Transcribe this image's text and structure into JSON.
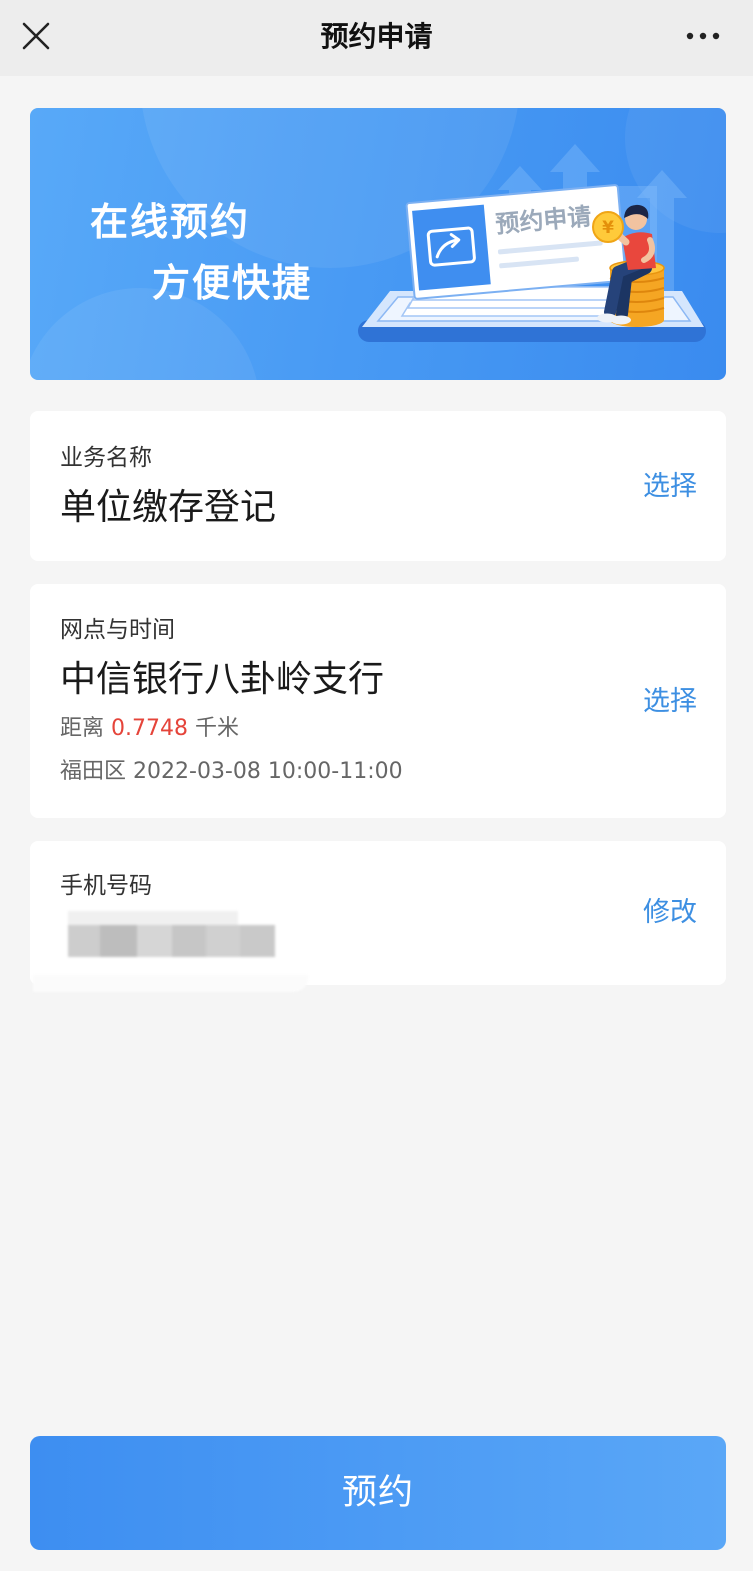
{
  "nav": {
    "title": "预约申请",
    "close_icon": "close-icon",
    "more_icon": "more-icon"
  },
  "banner": {
    "line1": "在线预约",
    "line2": "方便快捷",
    "illustration_text": "预约申请",
    "coin_symbol": "¥"
  },
  "business": {
    "label": "业务名称",
    "value": "单位缴存登记",
    "action": "选择"
  },
  "branch": {
    "label": "网点与时间",
    "name": "中信银行八卦岭支行",
    "distance_prefix": "距离",
    "distance_value": "0.7748",
    "distance_unit": "千米",
    "district": "福田区",
    "date": "2022-03-08",
    "time_range": "10:00-11:00",
    "action": "选择"
  },
  "phone": {
    "label": "手机号码",
    "action": "修改"
  },
  "submit": {
    "label": "预约"
  },
  "colors": {
    "accent": "#3d8fe2",
    "distance_highlight": "#e5443a",
    "primary_button": "#4a9bf4",
    "banner": "#4698f3",
    "page_background": "#f5f5f5"
  }
}
